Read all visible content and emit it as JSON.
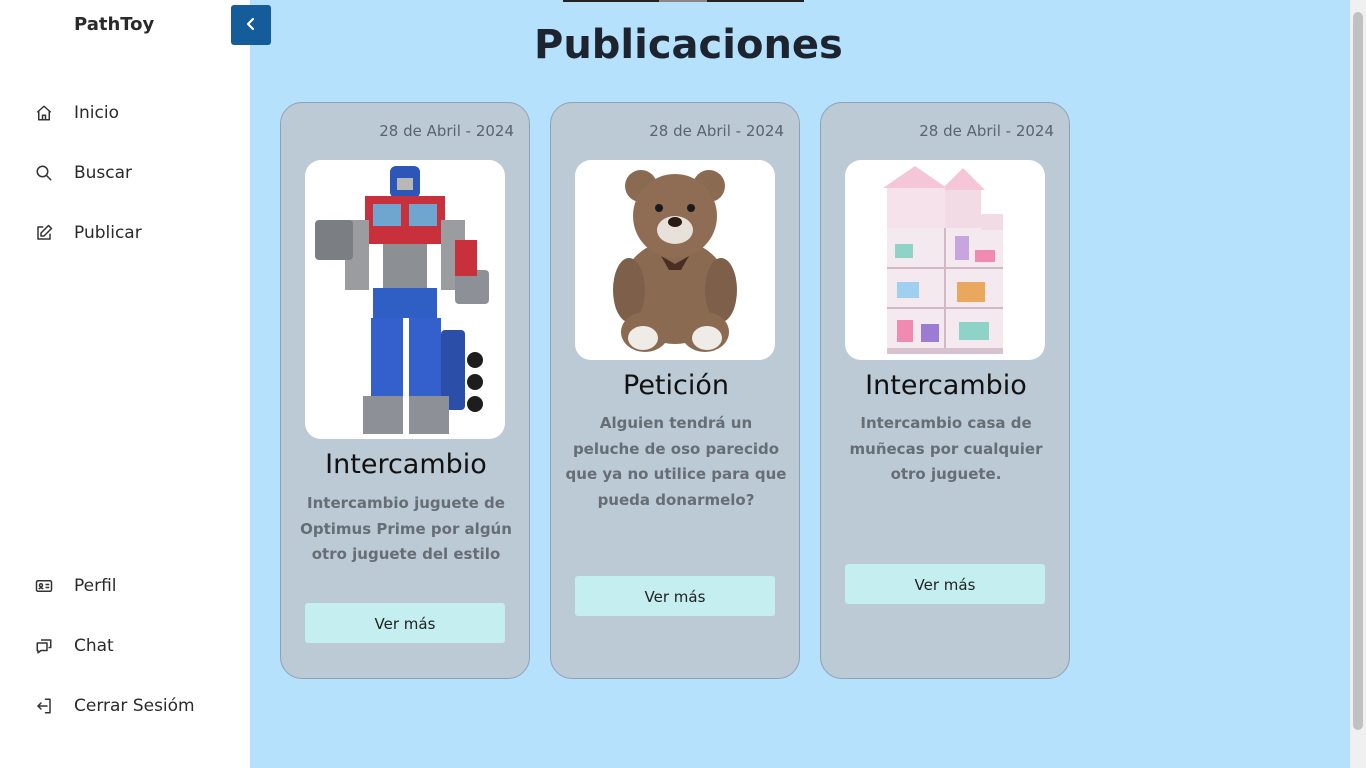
{
  "app": {
    "brand": "PathToy"
  },
  "sidebar": {
    "top_items": [
      {
        "label": "Inicio",
        "icon": "home-icon"
      },
      {
        "label": "Buscar",
        "icon": "search-icon"
      },
      {
        "label": "Publicar",
        "icon": "edit-icon"
      }
    ],
    "bottom_items": [
      {
        "label": "Perfil",
        "icon": "id-card-icon"
      },
      {
        "label": "Chat",
        "icon": "chat-icon"
      },
      {
        "label": "Cerrar Sesióm",
        "icon": "logout-icon"
      }
    ],
    "collapse_icon": "chevron-left-icon"
  },
  "main": {
    "title": "Publicaciones",
    "posts": [
      {
        "date": "28 de Abril - 2024",
        "image": "optimus-prime-toy",
        "type": "Intercambio",
        "description": "Intercambio juguete de Optimus Prime por algún otro juguete del estilo",
        "button": "Ver más"
      },
      {
        "date": "28 de Abril - 2024",
        "image": "teddy-bear-toy",
        "type": "Petición",
        "description": "Alguien tendrá un peluche de oso parecido que ya no utilice para que pueda donarmelo?",
        "button": "Ver más"
      },
      {
        "date": "28 de Abril - 2024",
        "image": "dollhouse-toy",
        "type": "Intercambio",
        "description": "Intercambio casa de muñecas por cualquier otro juguete.",
        "button": "Ver más"
      }
    ]
  },
  "colors": {
    "background": "#b5e1fc",
    "sidebar": "#ffffff",
    "card": "#bccad6",
    "button": "#c5eef0",
    "collapse_button": "#155c9a"
  }
}
